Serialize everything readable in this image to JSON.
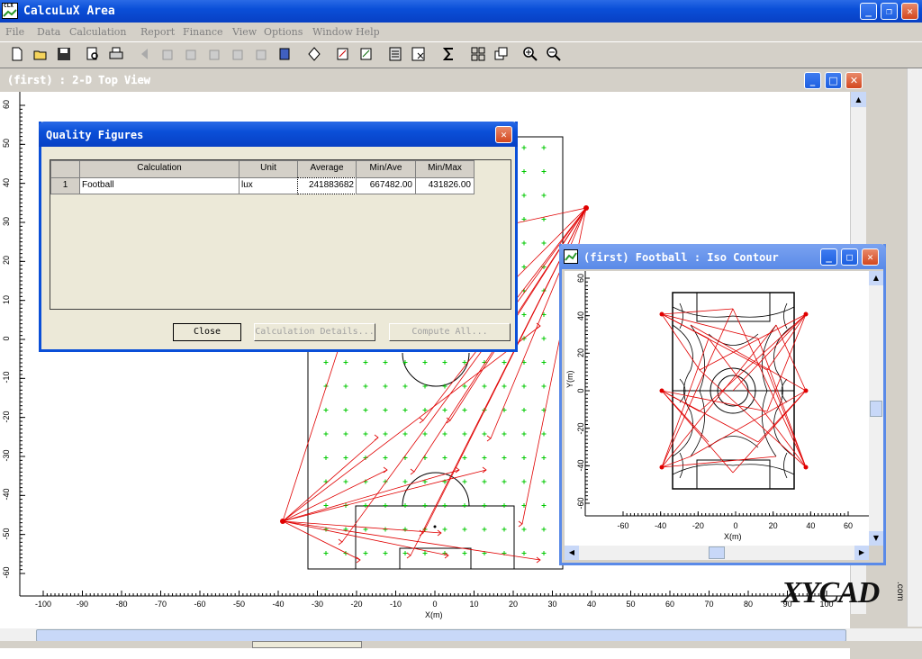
{
  "app": {
    "title": "CalcuLuX Area",
    "logo_text": "CLX"
  },
  "menu": [
    "File",
    "Data",
    "Calculation",
    "Report",
    "Finance",
    "View",
    "Options",
    "Window",
    "Help"
  ],
  "toolbar_icons": [
    "new-icon",
    "open-icon",
    "save-icon",
    "print-preview-icon",
    "print-icon",
    "back-icon",
    "view-3d-a-icon",
    "view-3d-b-icon",
    "view-3d-c-icon",
    "view-3d-d-icon",
    "view-3d-e-icon",
    "view-3d-f-icon",
    "luminaire-icon",
    "calc-a-icon",
    "calc-b-icon",
    "calculator-icon",
    "excel-icon",
    "sigma-icon",
    "tile-icon",
    "cascade-icon",
    "zoom-in-icon",
    "zoom-out-icon"
  ],
  "top_view": {
    "title": "(first)  : 2-D Top View",
    "x_axis_label": "X(m)",
    "x_ticks": [
      "-100",
      "-90",
      "-80",
      "-70",
      "-60",
      "-50",
      "-40",
      "-30",
      "-20",
      "-10",
      "0",
      "10",
      "20",
      "30",
      "40",
      "50",
      "60",
      "70",
      "80",
      "90",
      "100"
    ],
    "y_ticks": [
      "60",
      "50",
      "40",
      "30",
      "20",
      "10",
      "0",
      "-10",
      "-20",
      "-30",
      "-40",
      "-50",
      "-60"
    ]
  },
  "quality_figures": {
    "title": "Quality Figures",
    "columns": [
      "Calculation",
      "Unit",
      "Average",
      "Min/Ave",
      "Min/Max"
    ],
    "rows": [
      {
        "num": "1",
        "calculation": "Football",
        "unit": "lux",
        "average": "241883682",
        "min_ave": "667482.00",
        "min_max": "431826.00"
      }
    ],
    "buttons": {
      "close": "Close",
      "details": "Calculation Details...",
      "compute": "Compute All..."
    }
  },
  "iso_contour": {
    "title": "(first) Football : Iso Contour",
    "x_axis_label": "X(m)",
    "y_axis_label": "Y(m)",
    "x_ticks": [
      "-60",
      "-40",
      "-20",
      "0",
      "20",
      "40",
      "60"
    ],
    "y_ticks": [
      "60",
      "40",
      "20",
      "0",
      "-20",
      "-40",
      "-60"
    ]
  },
  "watermark": {
    "text": "XYCAD",
    "suffix": ".com"
  }
}
